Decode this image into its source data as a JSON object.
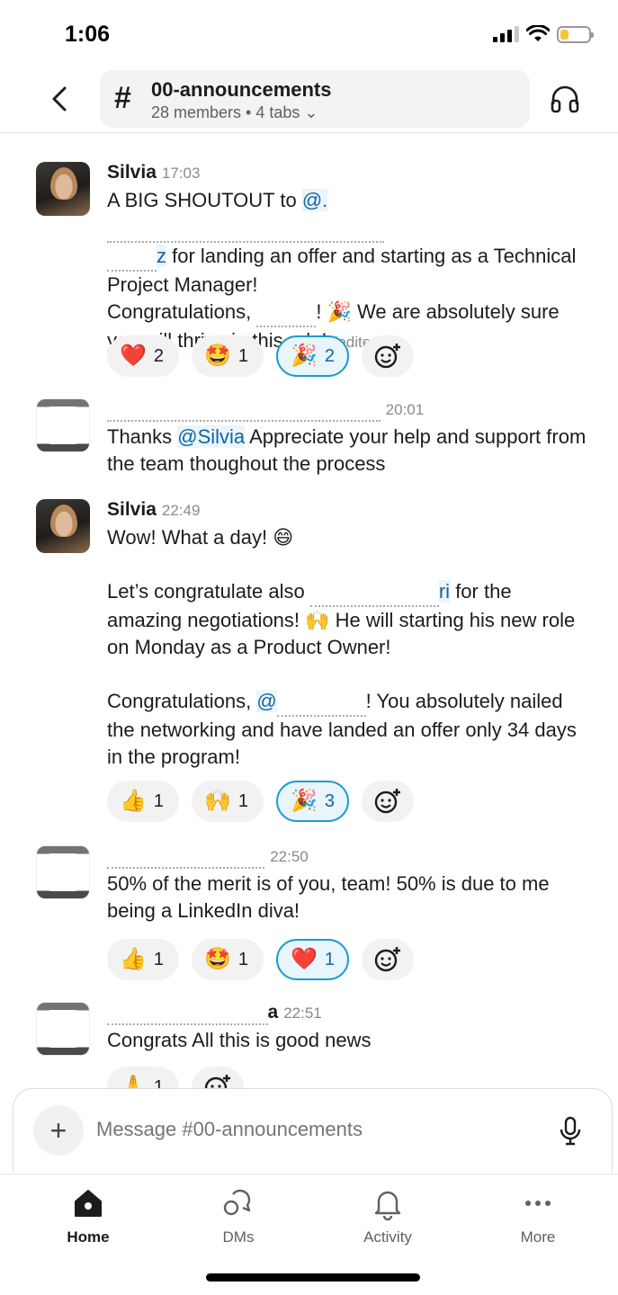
{
  "status_bar": {
    "time": "1:06"
  },
  "header": {
    "channel_name": "00-announcements",
    "channel_meta": "28 members • 4 tabs ⌄"
  },
  "messages": [
    {
      "author": "Silvia",
      "time": "17:03",
      "line1_pre": "A BIG SHOUTOUT to ",
      "mention1_a": "@.",
      "mention1_b": "z",
      "line2_post": " for landing an offer and starting as a Technical Project Manager!",
      "line3_pre": "Congratulations, ",
      "line3_post": "! 🎉 We are absolutely sure you will thrive in this role! ",
      "edited": "(edited)",
      "reactions": [
        {
          "emoji": "❤️",
          "count": "2",
          "active": false
        },
        {
          "emoji": "🤩",
          "count": "1",
          "active": false
        },
        {
          "emoji": "🎉",
          "count": "2",
          "active": true
        }
      ]
    },
    {
      "author": "",
      "time": "20:01",
      "text_pre": "Thanks ",
      "mention": "@Silvia",
      "text_post": " Appreciate your help and support from the team thoughout the process"
    },
    {
      "author": "Silvia",
      "time": "22:49",
      "p1": "Wow! What a day! 😄",
      "p2_pre": "Let’s congratulate also ",
      "p2_mention": "ri",
      "p2_post": " for the amazing negotiations! 🙌  He will starting his new role on Monday as a Product Owner!",
      "p3_pre": "Congratulations, ",
      "p3_mention": "@",
      "p3_post": "! You absolutely nailed the networking and have landed an offer only 34 days in the program!",
      "reactions": [
        {
          "emoji": "👍",
          "count": "1",
          "active": false
        },
        {
          "emoji": "🙌",
          "count": "1",
          "active": false
        },
        {
          "emoji": "🎉",
          "count": "3",
          "active": true
        }
      ]
    },
    {
      "author": "",
      "time": "22:50",
      "text": "50% of the merit is of you, team! 50% is due to me being a LinkedIn diva!",
      "reactions": [
        {
          "emoji": "👍",
          "count": "1",
          "active": false
        },
        {
          "emoji": "🤩",
          "count": "1",
          "active": false
        },
        {
          "emoji": "❤️",
          "count": "1",
          "active": true
        }
      ]
    },
    {
      "author": "a",
      "time": "22:51",
      "text": "Congrats All this is good news",
      "reactions": [
        {
          "emoji": "🙏",
          "count": "1",
          "active": false
        }
      ]
    }
  ],
  "composer": {
    "placeholder": "Message #00-announcements"
  },
  "tabbar": {
    "home": "Home",
    "dms": "DMs",
    "activity": "Activity",
    "more": "More"
  }
}
